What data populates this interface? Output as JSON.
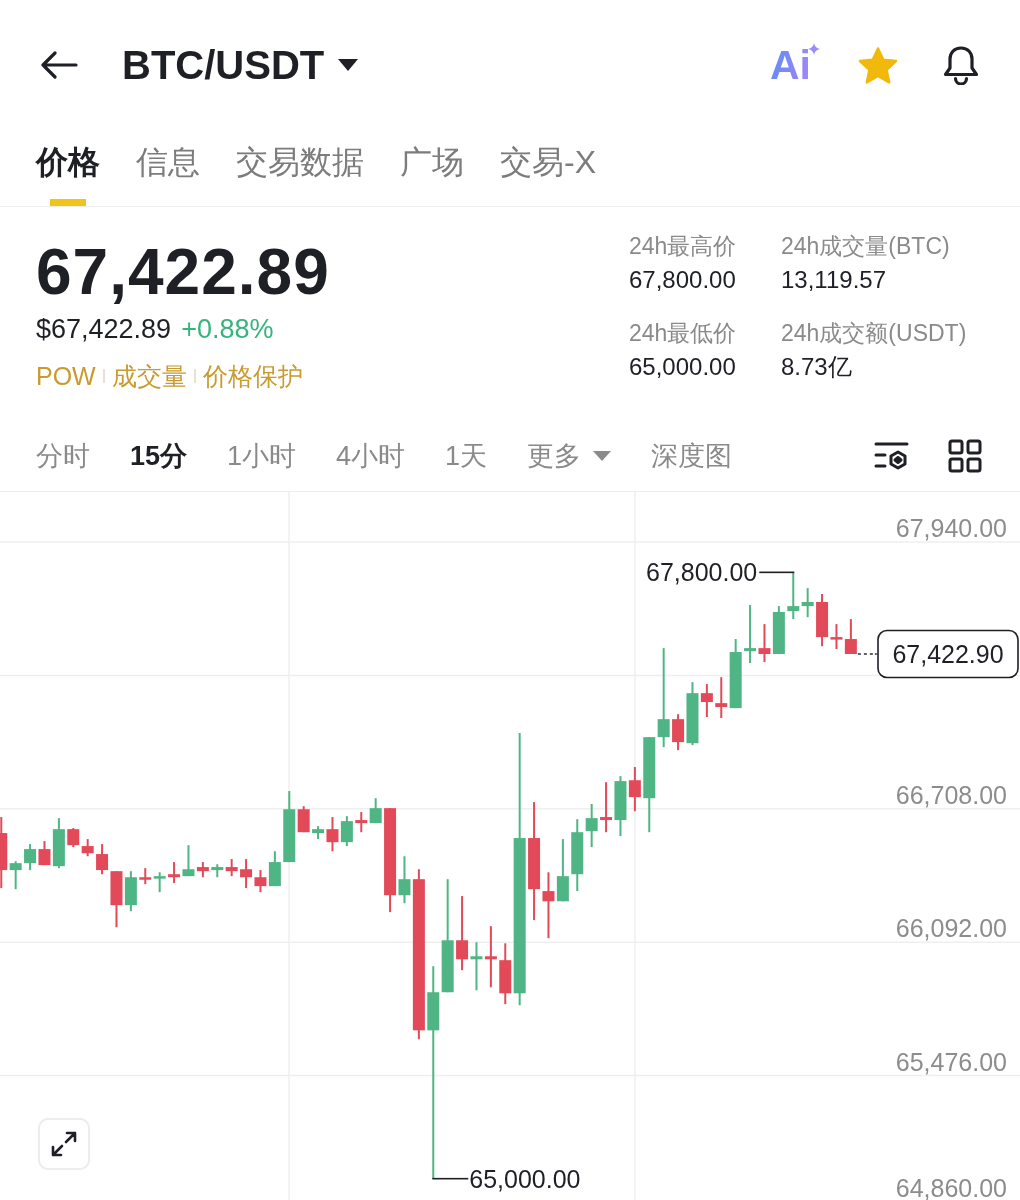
{
  "header": {
    "title": "BTC/USDT",
    "ai_label": "Ai",
    "favorited": true
  },
  "tabs": [
    {
      "label": "价格",
      "selected": true
    },
    {
      "label": "信息",
      "selected": false
    },
    {
      "label": "交易数据",
      "selected": false
    },
    {
      "label": "广场",
      "selected": false
    },
    {
      "label": "交易-X",
      "selected": false
    }
  ],
  "ticker": {
    "last_price": "67,422.89",
    "fiat_price": "$67,422.89",
    "change": "+0.88%",
    "tags": [
      "POW",
      "成交量",
      "价格保护"
    ]
  },
  "stats": [
    {
      "label": "24h最高价",
      "value": "67,800.00"
    },
    {
      "label": "24h成交量(BTC)",
      "value": "13,119.57"
    },
    {
      "label": "24h最低价",
      "value": "65,000.00"
    },
    {
      "label": "24h成交额(USDT)",
      "value": "8.73亿"
    }
  ],
  "intervals": [
    {
      "label": "分时",
      "kind": "option",
      "selected": false
    },
    {
      "label": "15分",
      "kind": "option",
      "selected": true
    },
    {
      "label": "1小时",
      "kind": "option",
      "selected": false
    },
    {
      "label": "4小时",
      "kind": "option",
      "selected": false
    },
    {
      "label": "1天",
      "kind": "option",
      "selected": false
    },
    {
      "label": "更多",
      "kind": "dropdown",
      "selected": false
    },
    {
      "label": "深度图",
      "kind": "option",
      "selected": false
    }
  ],
  "chart": {
    "chart_data": {
      "type": "candlestick",
      "grid": true,
      "ohlc": [
        [
          66596,
          66670,
          66342,
          66425
        ],
        [
          66425,
          66466,
          66337,
          66457
        ],
        [
          66457,
          66545,
          66425,
          66522
        ],
        [
          66522,
          66559,
          66448,
          66448
        ],
        [
          66443,
          66665,
          66434,
          66614
        ],
        [
          66614,
          66619,
          66531,
          66540
        ],
        [
          66536,
          66568,
          66489,
          66503
        ],
        [
          66499,
          66545,
          66406,
          66425
        ],
        [
          66420,
          66420,
          66161,
          66263
        ],
        [
          66263,
          66420,
          66235,
          66392
        ],
        [
          66392,
          66434,
          66360,
          66383
        ],
        [
          66388,
          66415,
          66323,
          66397
        ],
        [
          66406,
          66462,
          66365,
          66392
        ],
        [
          66397,
          66540,
          66397,
          66429
        ],
        [
          66439,
          66462,
          66392,
          66420
        ],
        [
          66425,
          66452,
          66392,
          66439
        ],
        [
          66439,
          66476,
          66397,
          66420
        ],
        [
          66429,
          66476,
          66342,
          66392
        ],
        [
          66392,
          66425,
          66323,
          66351
        ],
        [
          66351,
          66512,
          66351,
          66462
        ],
        [
          66462,
          66790,
          66462,
          66706
        ],
        [
          66706,
          66720,
          66600,
          66600
        ],
        [
          66596,
          66628,
          66568,
          66614
        ],
        [
          66614,
          66670,
          66512,
          66554
        ],
        [
          66554,
          66674,
          66536,
          66651
        ],
        [
          66656,
          66693,
          66600,
          66642
        ],
        [
          66642,
          66757,
          66642,
          66711
        ],
        [
          66711,
          66711,
          66231,
          66309
        ],
        [
          66309,
          66489,
          66272,
          66383
        ],
        [
          66383,
          66429,
          65644,
          65685
        ],
        [
          65685,
          65981,
          65000,
          65861
        ],
        [
          65861,
          66383,
          65861,
          66101
        ],
        [
          66101,
          66305,
          65963,
          66013
        ],
        [
          66013,
          66092,
          65870,
          66027
        ],
        [
          66027,
          66166,
          65884,
          66013
        ],
        [
          66009,
          66087,
          65806,
          65856
        ],
        [
          65856,
          67058,
          65801,
          66573
        ],
        [
          66573,
          66739,
          66194,
          66337
        ],
        [
          66328,
          66415,
          66111,
          66281
        ],
        [
          66281,
          66568,
          66281,
          66397
        ],
        [
          66406,
          66660,
          66328,
          66600
        ],
        [
          66605,
          66730,
          66531,
          66665
        ],
        [
          66670,
          66831,
          66600,
          66656
        ],
        [
          66656,
          66859,
          66582,
          66836
        ],
        [
          66840,
          66901,
          66697,
          66762
        ],
        [
          66757,
          67039,
          66600,
          67039
        ],
        [
          67039,
          67450,
          66993,
          67122
        ],
        [
          67122,
          67145,
          66979,
          67016
        ],
        [
          67011,
          67293,
          67002,
          67242
        ],
        [
          67242,
          67284,
          67132,
          67201
        ],
        [
          67196,
          67316,
          67127,
          67178
        ],
        [
          67173,
          67492,
          67173,
          67432
        ],
        [
          67436,
          67649,
          67381,
          67450
        ],
        [
          67450,
          67561,
          67386,
          67423
        ],
        [
          67423,
          67644,
          67423,
          67617
        ],
        [
          67621,
          67800,
          67584,
          67644
        ],
        [
          67644,
          67727,
          67593,
          67663
        ],
        [
          67663,
          67700,
          67459,
          67501
        ],
        [
          67501,
          67561,
          67446,
          67492
        ],
        [
          67492,
          67584,
          67422.9,
          67422.9
        ]
      ],
      "ylim": [
        64860,
        68171
      ],
      "yticks": [
        {
          "value": 67940,
          "label": "67,940.00"
        },
        {
          "value": 66708,
          "label": "66,708.00"
        },
        {
          "value": 66092,
          "label": "66,092.00"
        },
        {
          "value": 65476,
          "label": "65,476.00"
        },
        {
          "value": 64860,
          "label": "64,860.00"
        }
      ],
      "annotations": [
        "67,800.00",
        "65,000.00",
        "67,422.90"
      ]
    }
  }
}
